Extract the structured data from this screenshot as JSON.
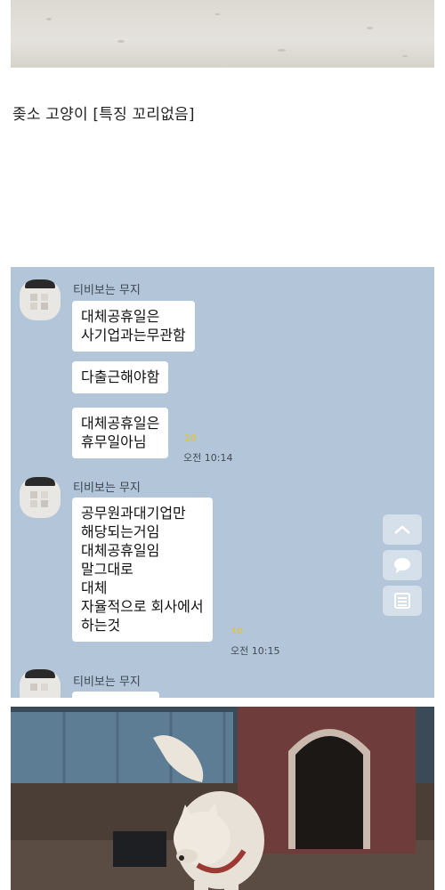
{
  "caption": "좆소 고양이 [특징 꼬리없음]",
  "chat": {
    "groups": [
      {
        "sender": "티비보는 무지",
        "messages": [
          {
            "text": "대체공휴일은\n사기업과는무관함",
            "unread": ""
          },
          {
            "text": "다출근해야함",
            "unread": ""
          },
          {
            "text": "대체공휴일은\n휴무일아님",
            "unread": "10"
          }
        ],
        "time": "오전 10:14"
      },
      {
        "sender": "티비보는 무지",
        "messages": [
          {
            "text": "공무원과대기업만\n해당되는거임\n대체공휴일임\n말그대로\n대체\n자율적으로 회사에서\n하는것",
            "unread": "10"
          }
        ],
        "time": "오전 10:15"
      },
      {
        "sender": "티비보는 무지",
        "messages": []
      }
    ],
    "side_buttons": [
      "chevron-up-icon",
      "chat-bubble-icon",
      "list-icon"
    ]
  }
}
